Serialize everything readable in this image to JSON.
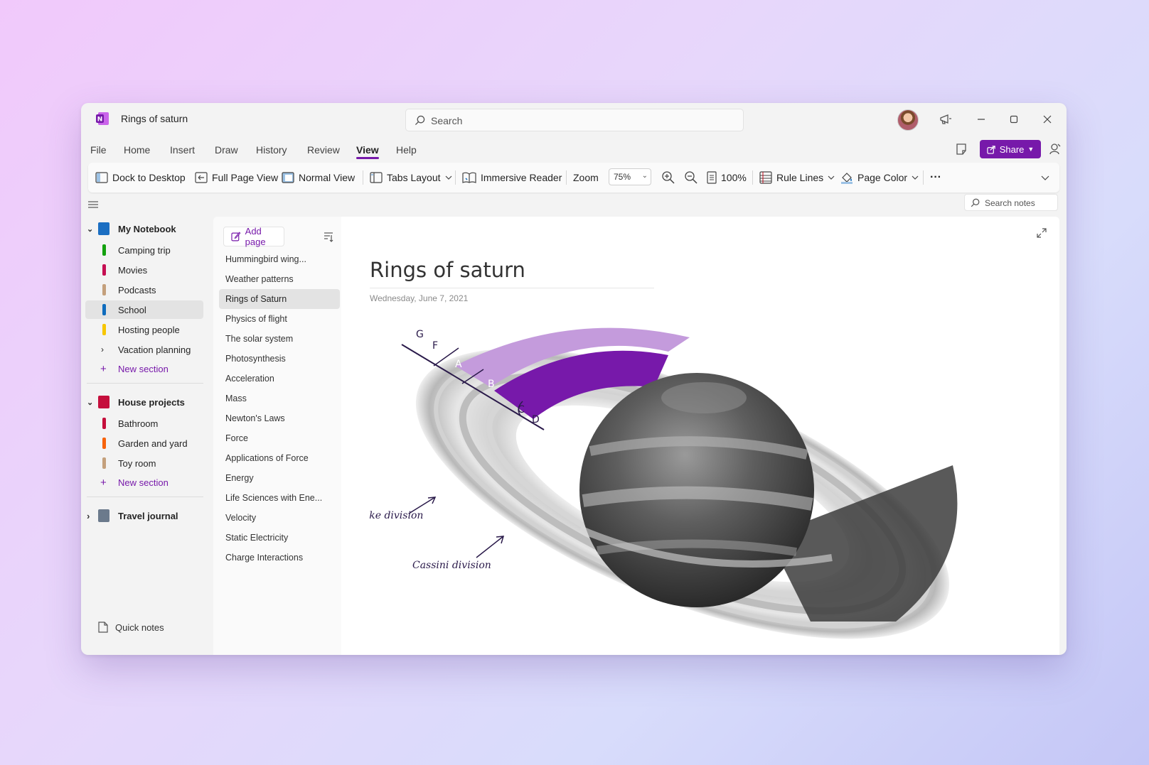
{
  "window": {
    "title": "Rings of saturn",
    "search_placeholder": "Search"
  },
  "menu": {
    "items": [
      "File",
      "Home",
      "Insert",
      "Draw",
      "History",
      "Review",
      "View",
      "Help"
    ],
    "active": "View",
    "share_label": "Share"
  },
  "ribbon": {
    "dock": "Dock to Desktop",
    "full_page": "Full Page View",
    "normal_view": "Normal View",
    "tabs_layout": "Tabs Layout",
    "immersive_reader": "Immersive Reader",
    "zoom_label": "Zoom",
    "zoom_value": "75%",
    "zoom_100": "100%",
    "rule_lines": "Rule Lines",
    "page_color": "Page Color",
    "more": "···"
  },
  "search_notes": "Search notes",
  "sidebar": {
    "notebooks": [
      {
        "name": "My Notebook",
        "color": "#1b6ec2",
        "sections": [
          {
            "name": "Camping trip",
            "color": "#13a10e"
          },
          {
            "name": "Movies",
            "color": "#c50f52"
          },
          {
            "name": "Podcasts",
            "color": "#c4a07c"
          },
          {
            "name": "School",
            "color": "#0f6cbd"
          },
          {
            "name": "Hosting people",
            "color": "#f7c600"
          },
          {
            "name": "Vacation planning",
            "color": ""
          }
        ],
        "new_section": "New section"
      },
      {
        "name": "House projects",
        "color": "#c50f3c",
        "sections": [
          {
            "name": "Bathroom",
            "color": "#c50f3c"
          },
          {
            "name": "Garden and yard",
            "color": "#f7630c"
          },
          {
            "name": "Toy room",
            "color": "#c4a07c"
          }
        ],
        "new_section": "New section"
      },
      {
        "name": "Travel journal",
        "color": "#6b7a8c"
      }
    ],
    "quick_notes": "Quick notes"
  },
  "pages": {
    "add_page": "Add page",
    "items": [
      "Hummingbird wing...",
      "Weather patterns",
      "Rings of Saturn",
      "Physics of flight",
      "The solar system",
      "Photosynthesis",
      "Acceleration",
      "Mass",
      "Newton's Laws",
      "Force",
      "Applications of Force",
      "Energy",
      "Life Sciences with Ene...",
      "Velocity",
      "Static Electricity",
      "Charge Interactions"
    ],
    "selected": "Rings of Saturn"
  },
  "note": {
    "title": "Rings of saturn",
    "date": "Wednesday, June 7, 2021",
    "ring_labels": [
      "G",
      "F",
      "A",
      "B",
      "C",
      "D"
    ],
    "annotations": [
      "Enke division",
      "Cassini division"
    ],
    "accent": "#7719aa"
  }
}
